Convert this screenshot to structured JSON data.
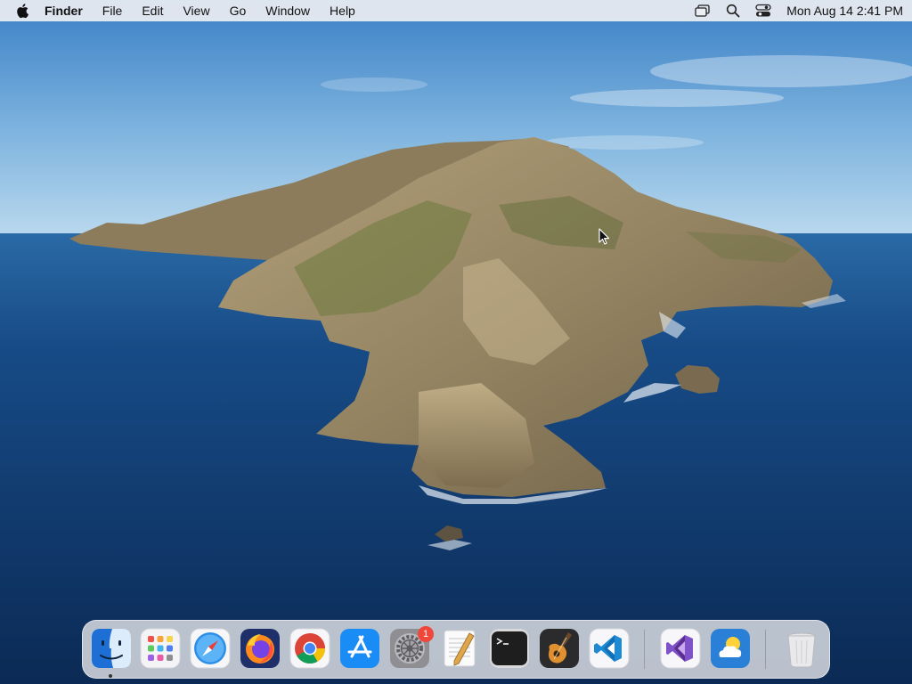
{
  "menubar": {
    "apple_icon": "apple-logo-icon",
    "app_name": "Finder",
    "menus": [
      "File",
      "Edit",
      "View",
      "Go",
      "Window",
      "Help"
    ],
    "status_icons": [
      "screen-mirroring-icon",
      "spotlight-search-icon",
      "control-center-icon"
    ],
    "clock": "Mon Aug 14  2:41 PM"
  },
  "desktop": {
    "wallpaper": "island-coast-wallpaper",
    "cursor_icon": "mouse-pointer-icon"
  },
  "dock": {
    "items": [
      {
        "name": "Finder",
        "icon": "finder-icon",
        "running": true
      },
      {
        "name": "Launchpad",
        "icon": "launchpad-icon"
      },
      {
        "name": "Safari",
        "icon": "safari-icon"
      },
      {
        "name": "Firefox",
        "icon": "firefox-icon"
      },
      {
        "name": "Chrome",
        "icon": "chrome-icon"
      },
      {
        "name": "App Store",
        "icon": "app-store-icon"
      },
      {
        "name": "System Settings",
        "icon": "system-settings-icon",
        "badge": "1"
      },
      {
        "name": "TextEdit",
        "icon": "textedit-icon"
      },
      {
        "name": "Terminal",
        "icon": "terminal-icon"
      },
      {
        "name": "GarageBand",
        "icon": "garageband-icon"
      },
      {
        "name": "Visual Studio Code",
        "icon": "vscode-icon"
      },
      {
        "name": "Visual Studio",
        "icon": "visual-studio-icon"
      },
      {
        "name": "Weather",
        "icon": "weather-icon"
      },
      {
        "name": "Trash",
        "icon": "trash-icon"
      }
    ],
    "badge_color": "#f0473a"
  }
}
